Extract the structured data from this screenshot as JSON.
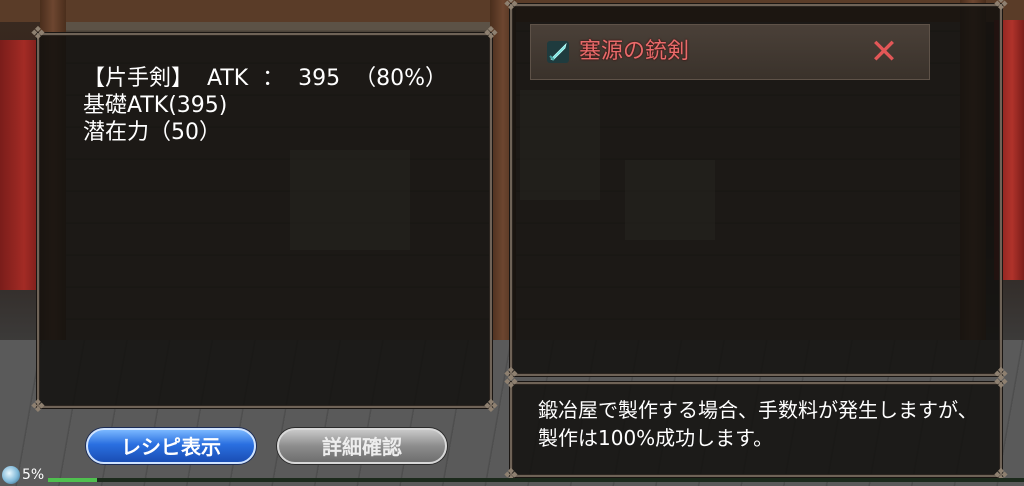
{
  "stats": {
    "line1": "【片手剣】  ATK  ：  395  （80%）",
    "line2": "基礎ATK(395)",
    "line3": "潜在力（50）"
  },
  "item": {
    "name": "塞源の銃剣",
    "icon": "sword-icon",
    "name_color": "#e86a6a",
    "close_icon": "close-icon",
    "close_glyph": "✕"
  },
  "description": "鍛冶屋で製作する場合、手数料が発生しますが、製作は100%成功します。",
  "buttons": {
    "recipe_label": "レシピ表示",
    "detail_label": "詳細確認"
  },
  "status": {
    "progress_text": "5%",
    "progress_value": 0.05
  },
  "colors": {
    "accent_red": "#e86a6a",
    "button_blue": "#2a6fe0",
    "button_gray": "#8d8d8d"
  }
}
